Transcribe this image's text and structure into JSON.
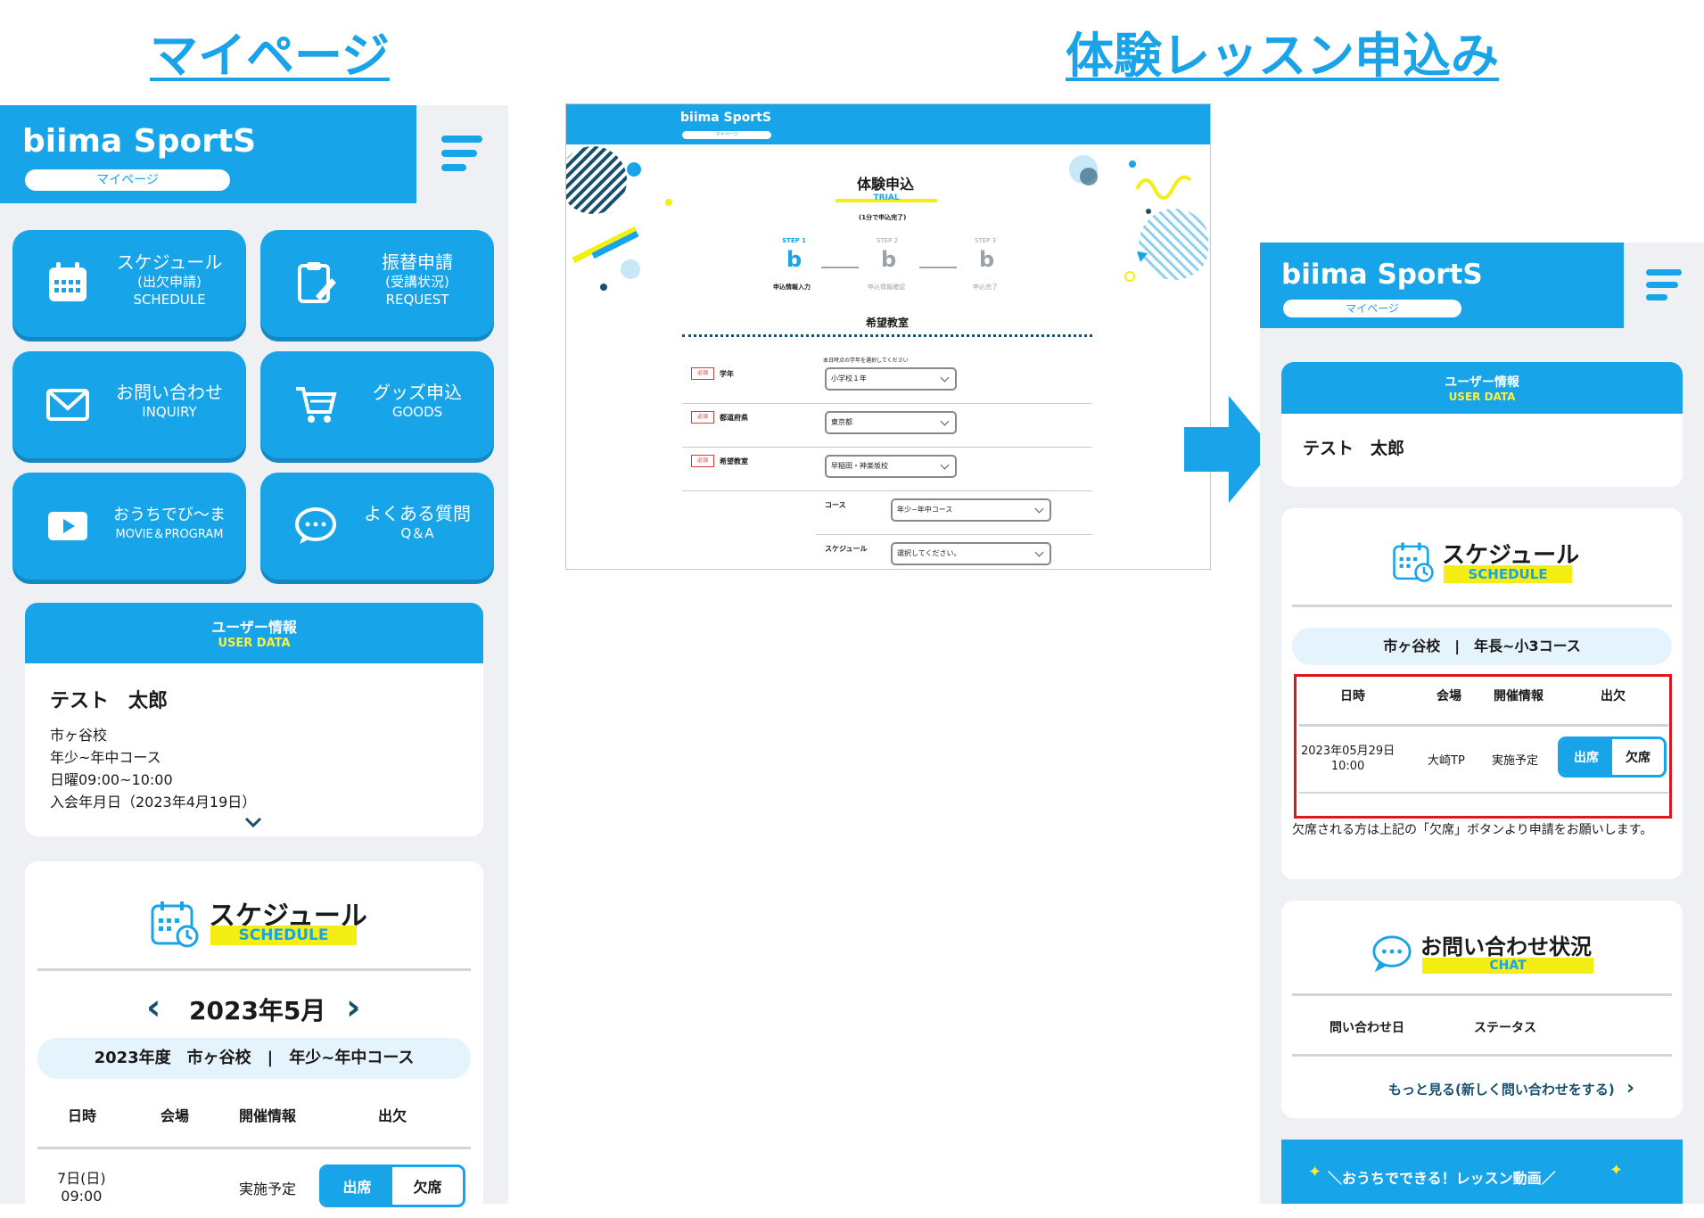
{
  "headings": {
    "mypage": "マイページ",
    "trial": "体験レッスン申込み"
  },
  "brand": {
    "logo": "biima SportS",
    "sub": "マイページ"
  },
  "tiles": [
    {
      "title": "スケジュール",
      "sub1": "(出欠申請)",
      "sub2": "SCHEDULE",
      "icon": "calendar-icon"
    },
    {
      "title": "振替申請",
      "sub1": "(受講状況)",
      "sub2": "REQUEST",
      "icon": "clipboard-icon"
    },
    {
      "title": "お問い合わせ",
      "sub1": "INQUIRY",
      "icon": "mail-icon"
    },
    {
      "title": "グッズ申込",
      "sub1": "GOODS",
      "icon": "cart-icon"
    },
    {
      "title": "おうちでび〜ま",
      "sub1": "MOVIE＆PROGRAM",
      "icon": "play-icon"
    },
    {
      "title": "よくある質問",
      "sub1": "Q＆A",
      "icon": "chat-icon"
    }
  ],
  "user_card": {
    "title": "ユーザー情報",
    "sub": "USER DATA",
    "name": "テスト　太郎",
    "lines": [
      "市ヶ谷校",
      "年少~年中コース",
      "日曜09:00~10:00",
      "入会年月日（2023年4月19日）"
    ]
  },
  "schedule": {
    "title": "スケジュール",
    "sub": "SCHEDULE",
    "month": "2023年5月",
    "prev": "‹",
    "next": "›",
    "course": "2023年度　市ヶ谷校　|　年少~年中コース",
    "cols": [
      "日時",
      "会場",
      "開催情報",
      "出欠"
    ],
    "row": {
      "date": "7日(日)",
      "time": "09:00",
      "info": "実施予定",
      "present": "出席",
      "absent": "欠席"
    }
  },
  "form": {
    "title": "体験申込",
    "trial": "TRIAL",
    "note": "(1分で申込完了)",
    "steps": [
      {
        "label": "STEP 1",
        "caption": "申込情報入力"
      },
      {
        "label": "STEP 2",
        "caption": "申込情報確認"
      },
      {
        "label": "STEP 3",
        "caption": "申込完了"
      }
    ],
    "section": "希望教室",
    "hint": "本日時点の学年を選択してください",
    "required": "必須",
    "fields": [
      {
        "label": "学年",
        "value": "小学校１年"
      },
      {
        "label": "都道府県",
        "value": "東京都"
      },
      {
        "label": "希望教室",
        "value": "早稲田・神楽坂校"
      },
      {
        "label": "コース",
        "value": "年少~年中コース"
      },
      {
        "label": "スケジュール",
        "value": "選択してください。"
      }
    ]
  },
  "right": {
    "user": {
      "title": "ユーザー情報",
      "sub": "USER DATA",
      "name": "テスト　太郎"
    },
    "schedule": {
      "title": "スケジュール",
      "sub": "SCHEDULE",
      "course": "市ヶ谷校　|　年長~小3コース",
      "cols": [
        "日時",
        "会場",
        "開催情報",
        "出欠"
      ],
      "row": {
        "date": "2023年05月29日",
        "time": "10:00",
        "venue": "大崎TP",
        "info": "実施予定",
        "present": "出席",
        "absent": "欠席"
      },
      "note": "欠席される方は上記の「欠席」ボタンより申請をお願いします。"
    },
    "chat": {
      "title": "お問い合わせ状況",
      "sub": "CHAT",
      "cols": [
        "問い合わせ日",
        "ステータス"
      ],
      "more": "もっと見る(新しく問い合わせをする)"
    },
    "banner": "＼おうちでできる！レッスン動画／"
  },
  "colors": {
    "brand": "#17a4e9",
    "highlight": "#f5ee13",
    "alert": "#e0161c"
  }
}
